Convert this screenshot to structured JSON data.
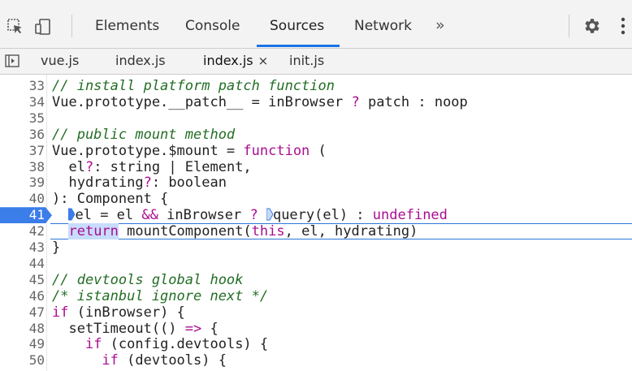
{
  "toolbar": {
    "tabs": [
      {
        "label": "Elements",
        "active": false
      },
      {
        "label": "Console",
        "active": false
      },
      {
        "label": "Sources",
        "active": true
      },
      {
        "label": "Network",
        "active": false
      }
    ],
    "more_label": "»",
    "accent_color": "#1a73e8"
  },
  "files": {
    "tabs": [
      {
        "label": "vue.js",
        "active": false
      },
      {
        "label": "index.js",
        "active": false
      },
      {
        "label": "index.js",
        "active": true,
        "close": "×"
      },
      {
        "label": "init.js",
        "active": false
      }
    ]
  },
  "editor": {
    "breakpoint_line": "41",
    "breakpoint_color": "#3b7de9",
    "lines": [
      {
        "num": "33",
        "tokens": [
          {
            "t": "// install platform patch function",
            "c": "comment"
          }
        ]
      },
      {
        "num": "34",
        "tokens": [
          {
            "t": "Vue.prototype.__patch__ = inBrowser ",
            "c": "plain"
          },
          {
            "t": "?",
            "c": "kw"
          },
          {
            "t": " patch : noop",
            "c": "plain"
          }
        ]
      },
      {
        "num": "35",
        "tokens": []
      },
      {
        "num": "36",
        "tokens": [
          {
            "t": "// public mount method",
            "c": "comment"
          }
        ]
      },
      {
        "num": "37",
        "tokens": [
          {
            "t": "Vue.prototype.$mount = ",
            "c": "plain"
          },
          {
            "t": "function",
            "c": "kw"
          },
          {
            "t": " (",
            "c": "plain"
          }
        ]
      },
      {
        "num": "38",
        "tokens": [
          {
            "t": "  el",
            "c": "plain"
          },
          {
            "t": "?",
            "c": "kw"
          },
          {
            "t": ": string | Element,",
            "c": "plain"
          }
        ]
      },
      {
        "num": "39",
        "tokens": [
          {
            "t": "  hydrating",
            "c": "plain"
          },
          {
            "t": "?",
            "c": "kw"
          },
          {
            "t": ": boolean",
            "c": "plain"
          }
        ]
      },
      {
        "num": "40",
        "tokens": [
          {
            "t": "): Component {",
            "c": "plain"
          }
        ]
      },
      {
        "num": "41",
        "tokens": [
          {
            "t": "  ",
            "c": "plain"
          },
          {
            "t": "el = el ",
            "c": "plain"
          },
          {
            "t": "&&",
            "c": "kw"
          },
          {
            "t": " inBrowser ",
            "c": "plain"
          },
          {
            "t": "?",
            "c": "kw"
          },
          {
            "t": " ",
            "c": "plain"
          },
          {
            "t": "query(el) : ",
            "c": "plain"
          },
          {
            "t": "undefined",
            "c": "kw"
          }
        ]
      },
      {
        "num": "42",
        "tokens": [
          {
            "t": "  ",
            "c": "plain"
          },
          {
            "t": "return",
            "c": "ret"
          },
          {
            "t": " mountComponent(",
            "c": "plain"
          },
          {
            "t": "this",
            "c": "kw"
          },
          {
            "t": ", el, hydrating)",
            "c": "plain"
          }
        ]
      },
      {
        "num": "43",
        "tokens": [
          {
            "t": "}",
            "c": "plain"
          }
        ]
      },
      {
        "num": "44",
        "tokens": []
      },
      {
        "num": "45",
        "tokens": [
          {
            "t": "// devtools global hook",
            "c": "comment"
          }
        ]
      },
      {
        "num": "46",
        "tokens": [
          {
            "t": "/* istanbul ignore next */",
            "c": "comment"
          }
        ]
      },
      {
        "num": "47",
        "tokens": [
          {
            "t": "if",
            "c": "kw"
          },
          {
            "t": " (inBrowser) {",
            "c": "plain"
          }
        ]
      },
      {
        "num": "48",
        "tokens": [
          {
            "t": "  setTimeout(() ",
            "c": "plain"
          },
          {
            "t": "=>",
            "c": "kw"
          },
          {
            "t": " {",
            "c": "plain"
          }
        ]
      },
      {
        "num": "49",
        "tokens": [
          {
            "t": "    ",
            "c": "plain"
          },
          {
            "t": "if",
            "c": "kw"
          },
          {
            "t": " (config.devtools) {",
            "c": "plain"
          }
        ]
      },
      {
        "num": "50",
        "tokens": [
          {
            "t": "      ",
            "c": "plain"
          },
          {
            "t": "if",
            "c": "kw"
          },
          {
            "t": " (devtools) {",
            "c": "plain"
          }
        ]
      }
    ]
  }
}
